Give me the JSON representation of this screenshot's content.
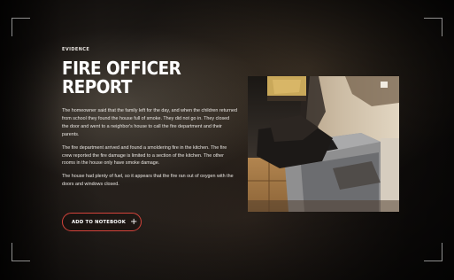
{
  "evidence": {
    "eyebrow": "EVIDENCE",
    "title_line1": "FIRE OFFICER",
    "title_line2": "REPORT",
    "paragraphs": [
      "The homeowner said that the family left for the day, and when the children returned from school they found the house full of smoke. They did not go in. They closed the door and went to a neighbor's house to call the fire department and their parents.",
      "The fire department arrived and found a smoldering fire in the kitchen. The fire crew reported the fire damage is limited to a section of the kitchen. The other rooms in the house only have smoke damage.",
      "The house had plenty of fuel, so it appears that the fire ran out of oxygen with the doors and windows closed."
    ],
    "button_label": "ADD TO NOTEBOOK",
    "button_icon": "+"
  },
  "colors": {
    "accent": "#d3433b",
    "text": "#ffffff"
  }
}
